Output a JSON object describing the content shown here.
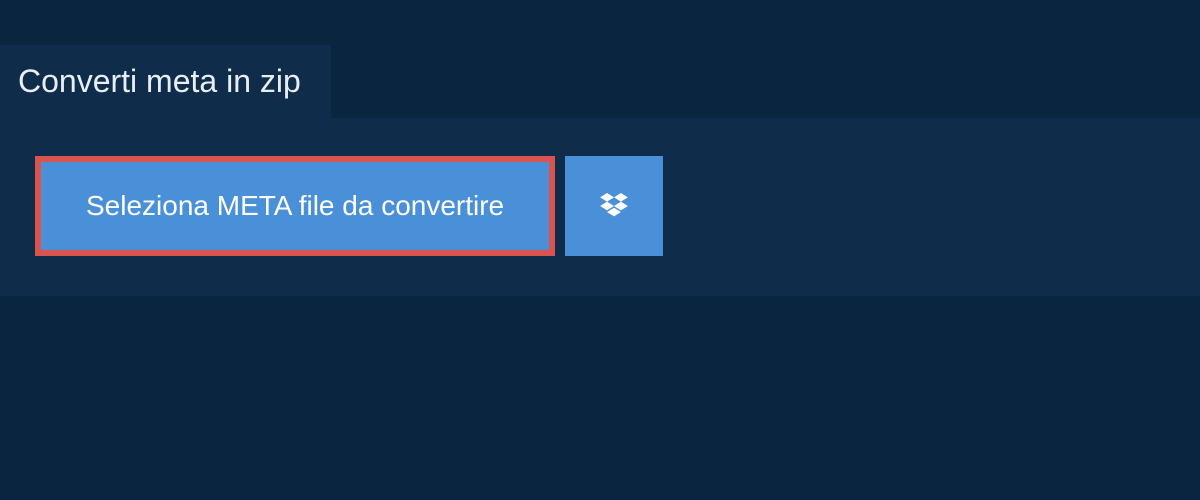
{
  "tab": {
    "label": "Converti meta in zip"
  },
  "actions": {
    "selectFile": "Seleziona META file da convertire"
  }
}
